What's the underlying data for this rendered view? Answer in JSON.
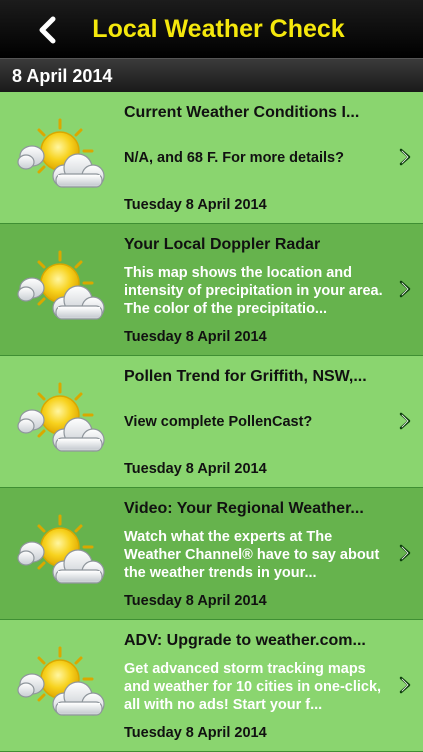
{
  "header": {
    "title": "Local Weather Check",
    "back_icon": "chevron-left-icon"
  },
  "section": {
    "title": "8 April 2014"
  },
  "items": [
    {
      "title": "Current Weather Conditions I...",
      "body": "N/A, and 68  F. For more details?",
      "date": "Tuesday 8 April 2014",
      "icon": "partly-cloudy-icon"
    },
    {
      "title": "Your Local Doppler Radar",
      "body": "This map shows the location and intensity of precipitation in your area. The color of the precipitatio...",
      "date": "Tuesday 8 April 2014",
      "icon": "partly-cloudy-icon"
    },
    {
      "title": "Pollen Trend for Griffith, NSW,...",
      "body": "View complete PollenCast?",
      "date": "Tuesday 8 April 2014",
      "icon": "partly-cloudy-icon"
    },
    {
      "title": "Video: Your Regional Weather...",
      "body": "Watch what the experts at The Weather Channel® have to say about the weather trends in your...",
      "date": "Tuesday 8 April 2014",
      "icon": "partly-cloudy-icon"
    },
    {
      "title": "ADV: Upgrade to weather.com...",
      "body": "Get advanced storm tracking maps and weather for 10 cities in one-click, all with no ads!  Start your f...",
      "date": "Tuesday 8 April 2014",
      "icon": "partly-cloudy-icon"
    }
  ],
  "colors": {
    "title_yellow": "#f5e80c",
    "row_light": "#8ad56f",
    "row_dark": "#66b34d"
  }
}
